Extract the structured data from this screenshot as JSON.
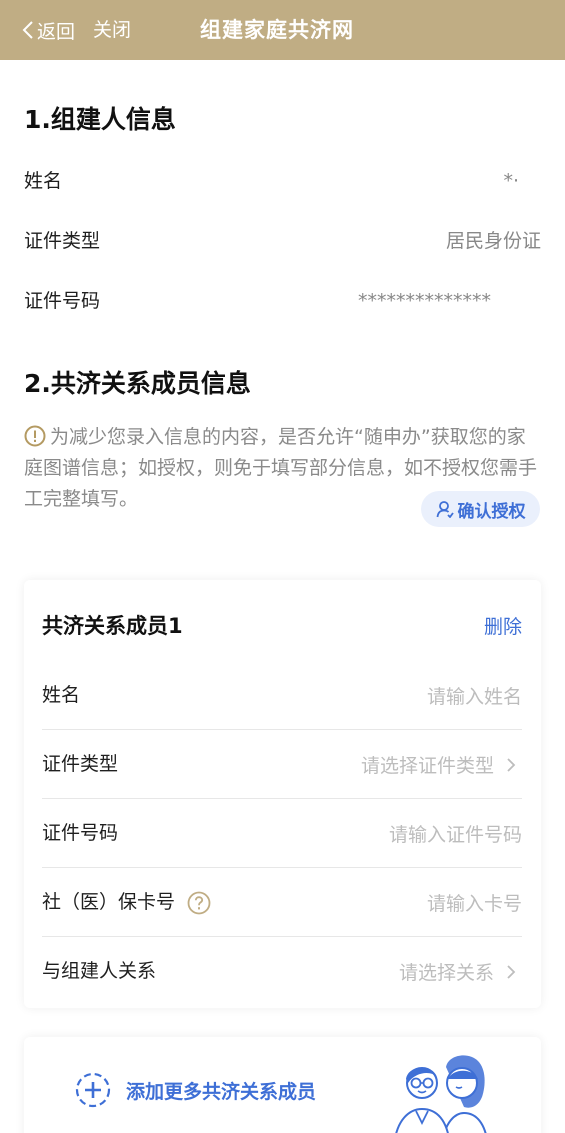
{
  "nav": {
    "back_label": "返回",
    "close_label": "关闭",
    "title": "组建家庭共济网"
  },
  "section1": {
    "title": "1.组建人信息",
    "rows": [
      {
        "label": "姓名",
        "value": "*·"
      },
      {
        "label": "证件类型",
        "value": "居民身份证"
      },
      {
        "label": "证件号码",
        "value": "**************"
      }
    ]
  },
  "section2": {
    "title": "2.共济关系成员信息",
    "notice": "为减少您录入信息的内容，是否允许“随申办”获取您的家庭图谱信息；如授权，则免于填写部分信息，如不授权您需手工完整填写。",
    "auth_button": "确认授权"
  },
  "member_card": {
    "title": "共济关系成员1",
    "delete_label": "删除",
    "fields": [
      {
        "label": "姓名",
        "placeholder": "请输入姓名"
      },
      {
        "label": "证件类型",
        "placeholder": "请选择证件类型"
      },
      {
        "label": "证件号码",
        "placeholder": "请输入证件号码"
      },
      {
        "label": "社（医）保卡号",
        "placeholder": "请输入卡号"
      },
      {
        "label": "与组建人关系",
        "placeholder": "请选择关系"
      }
    ]
  },
  "add_member": {
    "label": "添加更多共济关系成员"
  },
  "colors": {
    "header_bg": "#c0ad84",
    "accent_blue": "#3e6fd6",
    "placeholder_gray": "#bdbdbd",
    "help_icon": "#c0ad84"
  }
}
